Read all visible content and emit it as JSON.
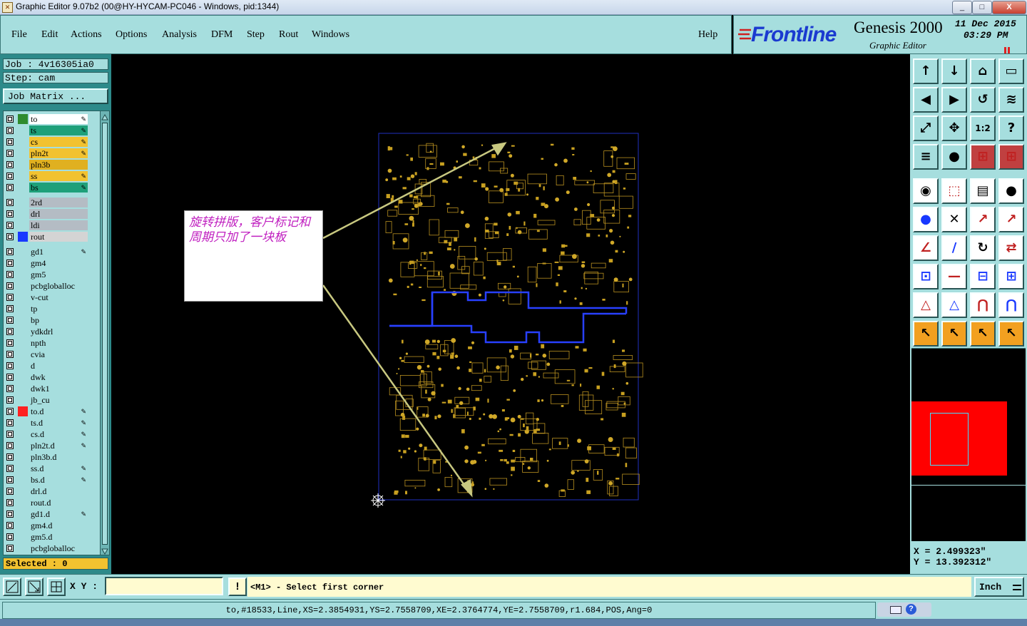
{
  "window": {
    "title": "Graphic Editor 9.07b2 (00@HY-HYCAM-PC046 - Windows, pid:1344)",
    "controls": [
      "_",
      "□",
      "X"
    ]
  },
  "menu": {
    "items": [
      "File",
      "Edit",
      "Actions",
      "Options",
      "Analysis",
      "DFM",
      "Step",
      "Rout",
      "Windows"
    ],
    "help": "Help"
  },
  "brand": {
    "logo": "Frontline",
    "product": "Genesis 2000",
    "subtitle": "Graphic Editor",
    "date": "11 Dec 2015",
    "time": "03:29 PM"
  },
  "job": {
    "job_label": "Job : 4v16305ia0",
    "step_label": "Step: cam",
    "matrix_button": "Job Matrix ..."
  },
  "layers": [
    {
      "name": "to",
      "color": "#2e8b2e",
      "bg": "#ffffff",
      "flag": "✎",
      "group": 0
    },
    {
      "name": "ts",
      "color": "",
      "bg": "#1ea07a",
      "flag": "✎",
      "group": 0
    },
    {
      "name": "cs",
      "color": "",
      "bg": "#f2c230",
      "flag": "✎",
      "group": 0
    },
    {
      "name": "pln2t",
      "color": "",
      "bg": "#f2c230",
      "flag": "✎",
      "group": 0
    },
    {
      "name": "pln3b",
      "color": "",
      "bg": "#e0b020",
      "flag": "",
      "group": 0
    },
    {
      "name": "ss",
      "color": "",
      "bg": "#f2c230",
      "flag": "✎",
      "group": 0
    },
    {
      "name": "bs",
      "color": "",
      "bg": "#1ea07a",
      "flag": "✎",
      "group": 0
    },
    {
      "name": "2rd",
      "color": "",
      "bg": "#b4bcc4",
      "flag": "",
      "group": 1
    },
    {
      "name": "drl",
      "color": "",
      "bg": "#b4bcc4",
      "flag": "",
      "group": 1
    },
    {
      "name": "ldi",
      "color": "",
      "bg": "#b4bcc4",
      "flag": "",
      "group": 1
    },
    {
      "name": "rout",
      "color": "#1838ff",
      "bg": "#d4d4d4",
      "flag": "",
      "group": 1
    },
    {
      "name": "gd1",
      "color": "",
      "bg": "#a6dede",
      "flag": "✎",
      "group": 2
    },
    {
      "name": "gm4",
      "color": "",
      "bg": "#a6dede",
      "flag": "",
      "group": 2
    },
    {
      "name": "gm5",
      "color": "",
      "bg": "#a6dede",
      "flag": "",
      "group": 2
    },
    {
      "name": "pcbgloballoc",
      "color": "",
      "bg": "#a6dede",
      "flag": "",
      "group": 2
    },
    {
      "name": "v-cut",
      "color": "",
      "bg": "#a6dede",
      "flag": "",
      "group": 2
    },
    {
      "name": "tp",
      "color": "",
      "bg": "#a6dede",
      "flag": "",
      "group": 2
    },
    {
      "name": "bp",
      "color": "",
      "bg": "#a6dede",
      "flag": "",
      "group": 2
    },
    {
      "name": "ydkdrl",
      "color": "",
      "bg": "#a6dede",
      "flag": "",
      "group": 2
    },
    {
      "name": "npth",
      "color": "",
      "bg": "#a6dede",
      "flag": "",
      "group": 2
    },
    {
      "name": "cvia",
      "color": "",
      "bg": "#a6dede",
      "flag": "",
      "group": 2
    },
    {
      "name": "d",
      "color": "",
      "bg": "#a6dede",
      "flag": "",
      "group": 2
    },
    {
      "name": "dwk",
      "color": "",
      "bg": "#a6dede",
      "flag": "",
      "group": 2
    },
    {
      "name": "dwk1",
      "color": "",
      "bg": "#a6dede",
      "flag": "",
      "group": 2
    },
    {
      "name": "jb_cu",
      "color": "",
      "bg": "#a6dede",
      "flag": "",
      "group": 2
    },
    {
      "name": "to.d",
      "color": "#ff2020",
      "bg": "#a6dede",
      "flag": "✎",
      "group": 2
    },
    {
      "name": "ts.d",
      "color": "",
      "bg": "#a6dede",
      "flag": "✎",
      "group": 2
    },
    {
      "name": "cs.d",
      "color": "",
      "bg": "#a6dede",
      "flag": "✎",
      "group": 2
    },
    {
      "name": "pln2t.d",
      "color": "",
      "bg": "#a6dede",
      "flag": "✎",
      "group": 2
    },
    {
      "name": "pln3b.d",
      "color": "",
      "bg": "#a6dede",
      "flag": "",
      "group": 2
    },
    {
      "name": "ss.d",
      "color": "",
      "bg": "#a6dede",
      "flag": "✎",
      "group": 2
    },
    {
      "name": "bs.d",
      "color": "",
      "bg": "#a6dede",
      "flag": "✎",
      "group": 2
    },
    {
      "name": "drl.d",
      "color": "",
      "bg": "#a6dede",
      "flag": "",
      "group": 2
    },
    {
      "name": "rout.d",
      "color": "",
      "bg": "#a6dede",
      "flag": "",
      "group": 2
    },
    {
      "name": "gd1.d",
      "color": "",
      "bg": "#a6dede",
      "flag": "✎",
      "group": 2
    },
    {
      "name": "gm4.d",
      "color": "",
      "bg": "#a6dede",
      "flag": "",
      "group": 2
    },
    {
      "name": "gm5.d",
      "color": "",
      "bg": "#a6dede",
      "flag": "",
      "group": 2
    },
    {
      "name": "pcbgloballoc",
      "color": "",
      "bg": "#a6dede",
      "flag": "",
      "group": 2
    }
  ],
  "selected": "Selected : 0",
  "annotation": {
    "text": "旋转拼版，客户标记和周期只加了一块板"
  },
  "coords": {
    "x": "X = 2.499323\"",
    "y": "Y = 13.392312\""
  },
  "bottom": {
    "xy_label": "X Y :",
    "xy_value": "",
    "warn": "!",
    "prompt": "<M1> - Select first corner",
    "units": "Inch"
  },
  "status": {
    "text": "to,#18533,Line,XS=2.3854931,YS=2.7558709,XE=2.3764774,YE=2.7558709,r1.684,POS,Ang=0"
  },
  "toolbar": {
    "icons": [
      "zoom-home-up-icon",
      "zoom-home-down-icon",
      "home-icon",
      "window-icon",
      "pan-left-icon",
      "pan-right-icon",
      "undo-icon",
      "redraw-icon",
      "fit-icon",
      "center-icon",
      "ratio-icon",
      "help-icon",
      "layer-settings-icon",
      "measure-icon",
      "snap-icon",
      "snap-alt-icon",
      "pad-icon",
      "line-icon",
      "ruler-icon",
      "pad-round-icon",
      "connect-icon",
      "cross-icon",
      "move-icon",
      "move-alt-icon",
      "angle-icon",
      "slope-icon",
      "arc-icon",
      "mirror-icon",
      "copy-icon",
      "break-icon",
      "resize-icon",
      "group-icon",
      "triangle-icon",
      "triangle-up-icon",
      "arch-icon",
      "arch-alt-icon",
      "select-icon",
      "select-box-icon",
      "select-poly-icon",
      "select-net-icon"
    ]
  }
}
